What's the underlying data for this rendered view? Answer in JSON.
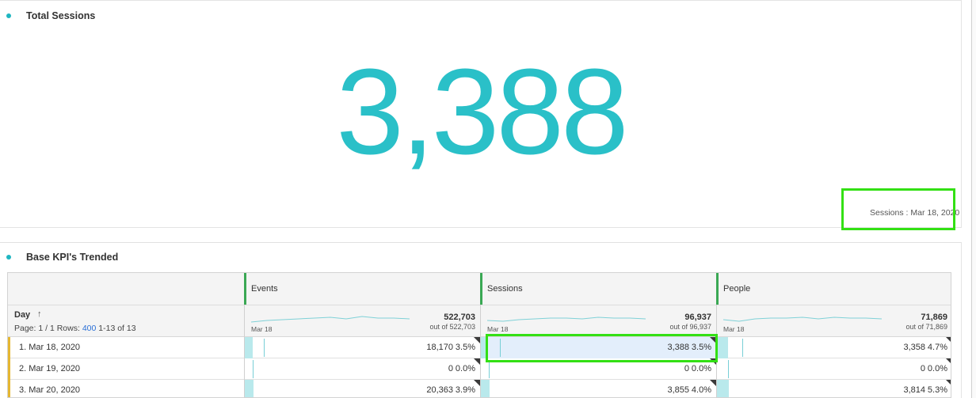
{
  "panel1": {
    "title": "Total Sessions",
    "big_value": "3,388",
    "caption": "Sessions : Mar 18, 2020"
  },
  "panel2": {
    "title": "Base KPI's Trended",
    "dimension": "Day",
    "sort_icon": "sort-up-arrow-icon",
    "paging_prefix": "Page: 1 / 1 Rows:",
    "rows_per_page": "400",
    "range": "1-13 of 13",
    "metrics": [
      {
        "name": "Events",
        "total": "522,703",
        "out_of": "out of 522,703",
        "spark_label": "Mar 18"
      },
      {
        "name": "Sessions",
        "total": "96,937",
        "out_of": "out of 96,937",
        "spark_label": "Mar 18"
      },
      {
        "name": "People",
        "total": "71,869",
        "out_of": "out of 71,869",
        "spark_label": "Mar 18"
      }
    ],
    "rows": [
      {
        "label": "1. Mar 18, 2020",
        "cells": [
          {
            "value": "18,170",
            "pct": "3.5%",
            "share": 0.035
          },
          {
            "value": "3,388",
            "pct": "3.5%",
            "share": 0.035
          },
          {
            "value": "3,358",
            "pct": "4.7%",
            "share": 0.047
          }
        ]
      },
      {
        "label": "2. Mar 19, 2020",
        "cells": [
          {
            "value": "0",
            "pct": "0.0%",
            "share": 0.0
          },
          {
            "value": "0",
            "pct": "0.0%",
            "share": 0.0
          },
          {
            "value": "0",
            "pct": "0.0%",
            "share": 0.0
          }
        ]
      },
      {
        "label": "3. Mar 20, 2020",
        "cells": [
          {
            "value": "20,363",
            "pct": "3.9%",
            "share": 0.039
          },
          {
            "value": "3,855",
            "pct": "4.0%",
            "share": 0.04
          },
          {
            "value": "3,814",
            "pct": "5.3%",
            "share": 0.053
          }
        ]
      }
    ]
  },
  "colors": {
    "accent": "#2ac0c8",
    "highlight": "#33e014",
    "row_marker": "#e5b732",
    "link": "#2a6fd6"
  }
}
